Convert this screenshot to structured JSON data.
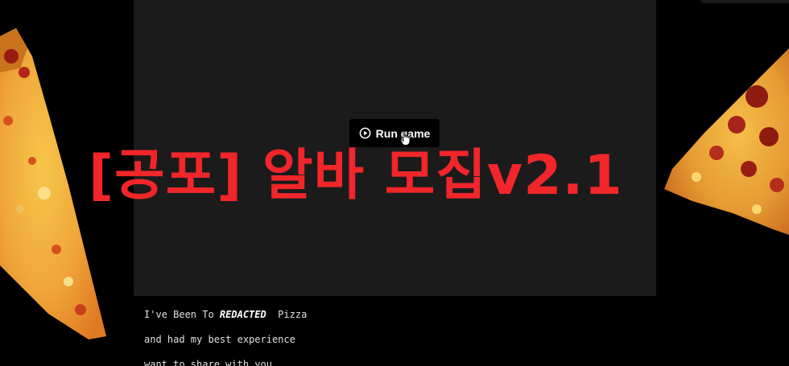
{
  "game": {
    "run_label": "Run game"
  },
  "title": "[공포] 알바 모집v2.1",
  "description": {
    "line1_before": "I've Been To ",
    "line1_redacted": "REDACTED",
    "line1_after": "  Pizza",
    "line2": "and had my best experience",
    "line3": "want to share with you"
  },
  "colors": {
    "title": "#f0262a",
    "frame": "#1b1b1b",
    "background": "#000000"
  },
  "icons": {
    "play": "play-circle-icon",
    "cursor": "hand-cursor-icon"
  }
}
